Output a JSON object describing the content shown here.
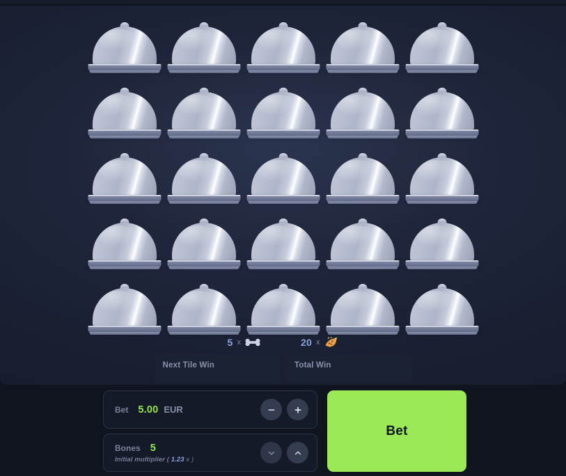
{
  "board": {
    "rows": 5,
    "cols": 5,
    "tile_icon": "cloche-dome-icon",
    "tiles": [
      "tile-1",
      "tile-2",
      "tile-3",
      "tile-4",
      "tile-5",
      "tile-6",
      "tile-7",
      "tile-8",
      "tile-9",
      "tile-10",
      "tile-11",
      "tile-12",
      "tile-13",
      "tile-14",
      "tile-15",
      "tile-16",
      "tile-17",
      "tile-18",
      "tile-19",
      "tile-20",
      "tile-21",
      "tile-22",
      "tile-23",
      "tile-24",
      "tile-25"
    ]
  },
  "counters": [
    {
      "count": "5",
      "x": "x",
      "icon": "bone-icon"
    },
    {
      "count": "20",
      "x": "x",
      "icon": "food-icon"
    }
  ],
  "win_panels": [
    {
      "label": "Next Tile Win",
      "value": ""
    },
    {
      "label": "Total Win",
      "value": ""
    }
  ],
  "bet_panel": {
    "label": "Bet",
    "amount": "5.00",
    "currency": "EUR",
    "decrease_label": "−",
    "increase_label": "+"
  },
  "bones_panel": {
    "label": "Bones",
    "value": "5",
    "sub_prefix": "Initial multiplier (",
    "sub_multiplier": "1.23",
    "sub_suffix": "x )",
    "decrease_label": "chevron-down",
    "increase_label": "chevron-up"
  },
  "bet_button": {
    "label": "Bet"
  },
  "colors": {
    "accent_green": "#9be957",
    "value_green": "#93e84f",
    "accent_blue": "#8ea4de",
    "board_bg": "#1e253a",
    "page_bg": "#0f141f",
    "panel_bg": "#141a28",
    "panel_border": "#2b3347",
    "win_box_bg": "#1b2234"
  }
}
